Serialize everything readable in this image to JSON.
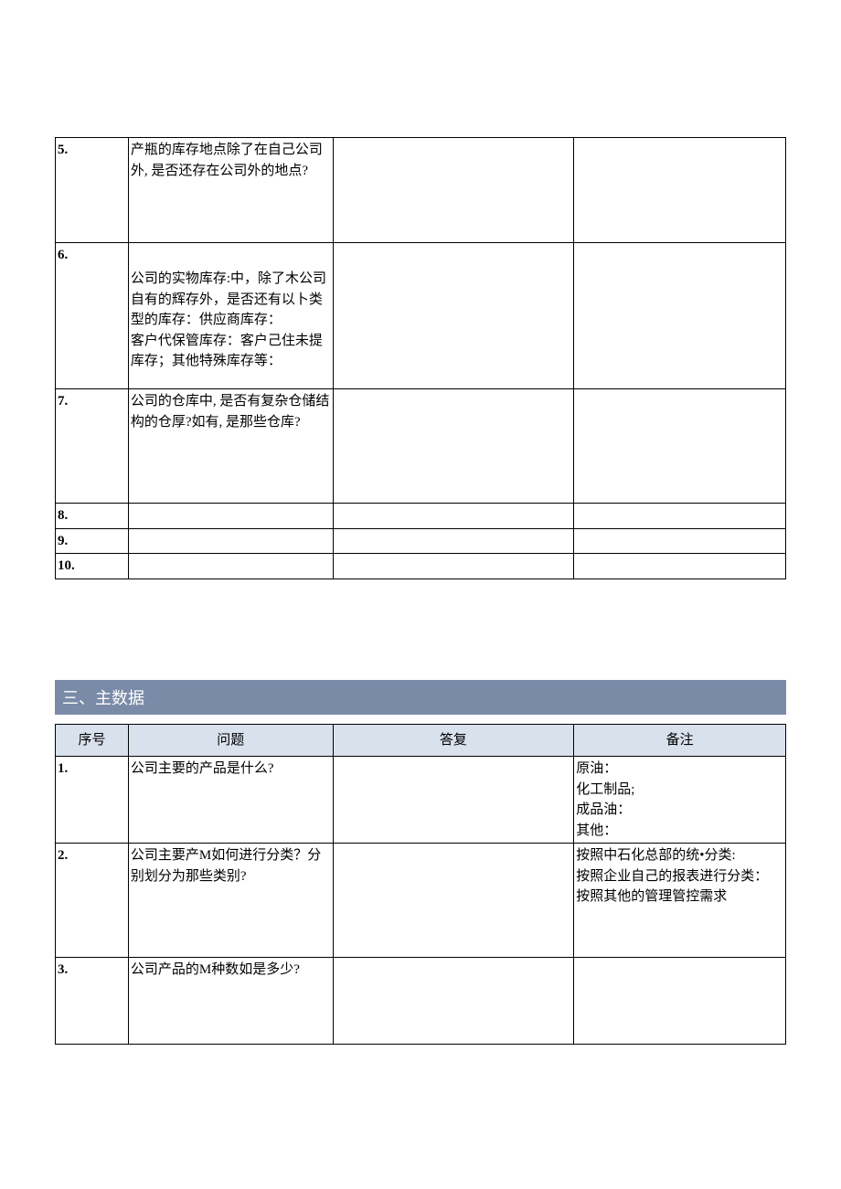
{
  "table1": {
    "rows": [
      {
        "idx": "5.",
        "question": "产瓶的库存地点除了在自己公司外, 是否还存在公司外的地点?",
        "answer": "",
        "remark": ""
      },
      {
        "idx": "6.",
        "question": "公司的实物库存:中，除了木公司自有的辉存外，是否还有以卜类型的库存：供应商库存：\n客户代保管库存：客户己住未提库存；其他特殊库存等：",
        "answer": "",
        "remark": ""
      },
      {
        "idx": "7.",
        "question": "公司的仓库中, 是否有复杂仓储结构的仓厚?如有, 是那些仓库?",
        "answer": "",
        "remark": ""
      },
      {
        "idx": "8.",
        "question": "",
        "answer": "",
        "remark": ""
      },
      {
        "idx": "9.",
        "question": "",
        "answer": "",
        "remark": ""
      },
      {
        "idx": "10.",
        "question": "",
        "answer": "",
        "remark": ""
      }
    ]
  },
  "section_title": "三、主数据",
  "table2": {
    "headers": {
      "idx": "序号",
      "question": "问题",
      "answer": "答复",
      "remark": "备注"
    },
    "rows": [
      {
        "idx": "1.",
        "question": "公司主要的产品是什么?",
        "answer": "",
        "remark": "原油：\n化工制品;\n成品油：\n其他："
      },
      {
        "idx": "2.",
        "question": "公司主要产M如何进行分类？分别划分为那些类别?",
        "answer": "",
        "remark": "按照中石化总部的统•分类:\n按照企业自己的报表进行分类：\n按照其他的管理管控需求"
      },
      {
        "idx": "3.",
        "question": "公司产品的M种数如是多少?",
        "answer": "",
        "remark": ""
      }
    ]
  }
}
